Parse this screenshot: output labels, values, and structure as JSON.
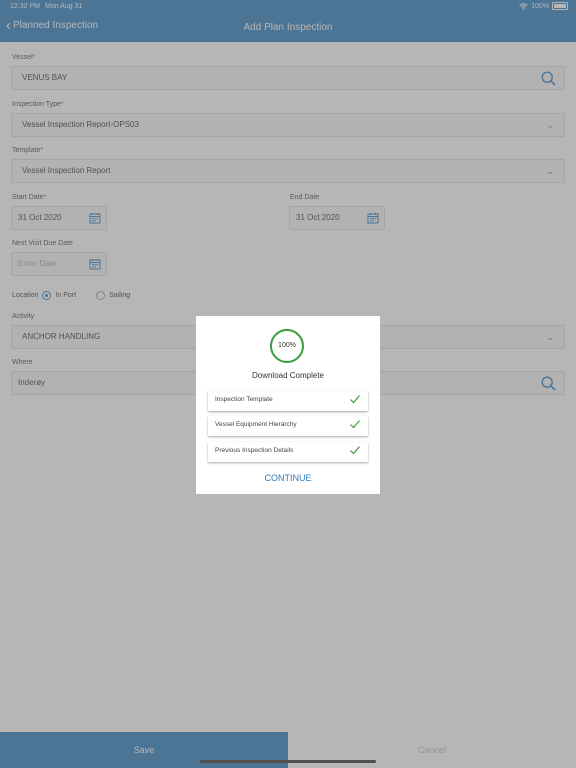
{
  "status_bar": {
    "time": "12:32 PM",
    "date": "Mon Aug 31",
    "battery": "100%"
  },
  "nav": {
    "back_label": "Planned Inspection",
    "title": "Add Plan Inspection"
  },
  "form": {
    "vessel": {
      "label": "Vessel",
      "value": "VENUS BAY"
    },
    "inspection_type": {
      "label": "Inspection Type",
      "value": "Vessel Inspection Report-OPS03"
    },
    "template": {
      "label": "Template",
      "value": "Vessel Inspection Report"
    },
    "start_date": {
      "label": "Start Date",
      "value": "31 Oct 2020"
    },
    "end_date": {
      "label": "End Date",
      "value": "31 Oct 2020"
    },
    "next_visit": {
      "label": "Next Visit Due Date",
      "placeholder": "Enter Date"
    },
    "location": {
      "label": "Location",
      "options": [
        "In Port",
        "Sailing"
      ],
      "selected": "In Port"
    },
    "activity": {
      "label": "Activity",
      "value": "ANCHOR HANDLING"
    },
    "where": {
      "label": "Where",
      "value": "Inderøy"
    },
    "required_mark": "*"
  },
  "bottom": {
    "save_label": "Save",
    "cancel_label": "Cancel"
  },
  "modal": {
    "progress": "100%",
    "title": "Download Complete",
    "items": [
      {
        "label": "Inspection Template"
      },
      {
        "label": "Vessel Equipment Hierarchy"
      },
      {
        "label": "Previous Inspection Details"
      }
    ],
    "continue_label": "CONTINUE"
  },
  "colors": {
    "primary": "#2a7bbd",
    "success": "#3a9c3a",
    "required": "#d33333"
  }
}
